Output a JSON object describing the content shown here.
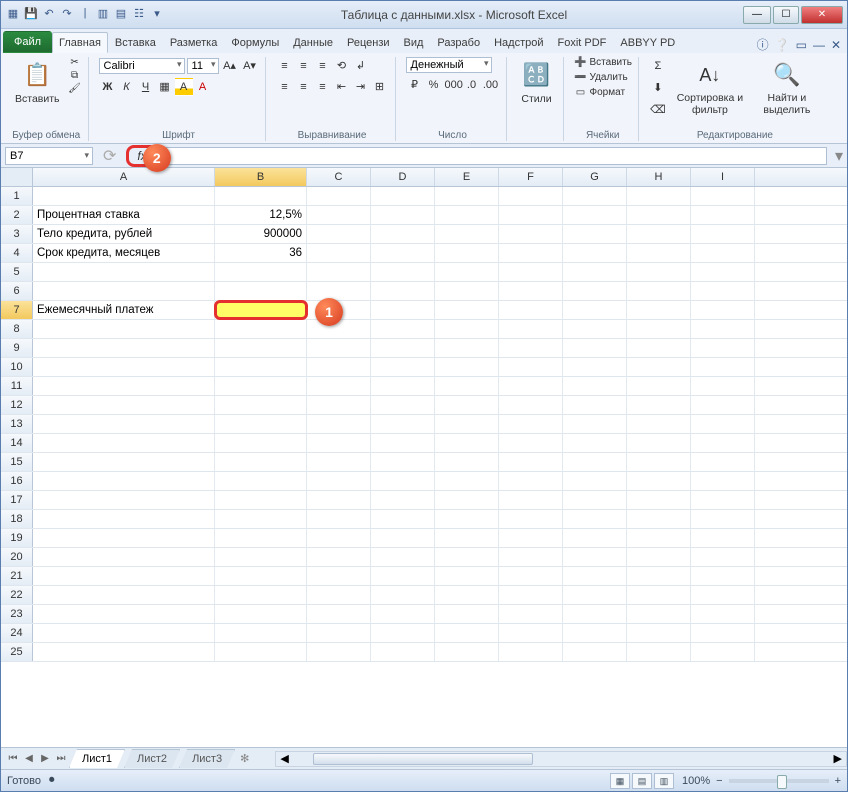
{
  "window": {
    "title": "Таблица с данными.xlsx - Microsoft Excel"
  },
  "qat": [
    "excel-icon",
    "save",
    "undo",
    "redo",
    "|",
    "qat1",
    "qat2",
    "qat3",
    "qat4"
  ],
  "tabs": {
    "file": "Файл",
    "items": [
      "Главная",
      "Вставка",
      "Разметка",
      "Формулы",
      "Данные",
      "Рецензи",
      "Вид",
      "Разрабо",
      "Надстрой",
      "Foxit PDF",
      "ABBYY PD"
    ],
    "active_index": 0
  },
  "ribbon": {
    "clipboard": {
      "paste": "Вставить",
      "label": "Буфер обмена"
    },
    "font": {
      "name": "Calibri",
      "size": "11",
      "label": "Шрифт"
    },
    "align": {
      "label": "Выравнивание"
    },
    "number": {
      "format": "Денежный",
      "label": "Число"
    },
    "styles": {
      "btn": "Стили"
    },
    "cells": {
      "insert": "Вставить",
      "delete": "Удалить",
      "format": "Формат",
      "label": "Ячейки"
    },
    "editing": {
      "sort": "Сортировка и фильтр",
      "find": "Найти и выделить",
      "label": "Редактирование"
    }
  },
  "namebox": "B7",
  "formula": "",
  "columns": [
    "A",
    "B",
    "C",
    "D",
    "E",
    "F",
    "G",
    "H",
    "I"
  ],
  "col_widths": [
    "colA",
    "colB",
    "colC",
    "colD",
    "colE",
    "colF",
    "colG",
    "colH",
    "colI"
  ],
  "selected_col_index": 1,
  "rows": [
    {
      "n": 1,
      "cells": [
        "",
        "",
        "",
        "",
        "",
        "",
        "",
        "",
        ""
      ]
    },
    {
      "n": 2,
      "cells": [
        "Процентная ставка",
        "12,5%",
        "",
        "",
        "",
        "",
        "",
        "",
        ""
      ],
      "num_cols": [
        1
      ]
    },
    {
      "n": 3,
      "cells": [
        "Тело кредита, рублей",
        "900000",
        "",
        "",
        "",
        "",
        "",
        "",
        ""
      ],
      "num_cols": [
        1
      ]
    },
    {
      "n": 4,
      "cells": [
        "Срок кредита, месяцев",
        "36",
        "",
        "",
        "",
        "",
        "",
        "",
        ""
      ],
      "num_cols": [
        1
      ]
    },
    {
      "n": 5,
      "cells": [
        "",
        "",
        "",
        "",
        "",
        "",
        "",
        "",
        ""
      ]
    },
    {
      "n": 6,
      "cells": [
        "",
        "",
        "",
        "",
        "",
        "",
        "",
        "",
        ""
      ]
    },
    {
      "n": 7,
      "cells": [
        "Ежемесячный платеж",
        "",
        "",
        "",
        "",
        "",
        "",
        "",
        ""
      ],
      "selected_col": 1
    },
    {
      "n": 8,
      "cells": [
        "",
        "",
        "",
        "",
        "",
        "",
        "",
        "",
        ""
      ]
    },
    {
      "n": 9,
      "cells": [
        "",
        "",
        "",
        "",
        "",
        "",
        "",
        "",
        ""
      ]
    },
    {
      "n": 10,
      "cells": [
        "",
        "",
        "",
        "",
        "",
        "",
        "",
        "",
        ""
      ]
    },
    {
      "n": 11,
      "cells": [
        "",
        "",
        "",
        "",
        "",
        "",
        "",
        "",
        ""
      ]
    },
    {
      "n": 12,
      "cells": [
        "",
        "",
        "",
        "",
        "",
        "",
        "",
        "",
        ""
      ]
    },
    {
      "n": 13,
      "cells": [
        "",
        "",
        "",
        "",
        "",
        "",
        "",
        "",
        ""
      ]
    },
    {
      "n": 14,
      "cells": [
        "",
        "",
        "",
        "",
        "",
        "",
        "",
        "",
        ""
      ]
    },
    {
      "n": 15,
      "cells": [
        "",
        "",
        "",
        "",
        "",
        "",
        "",
        "",
        ""
      ]
    },
    {
      "n": 16,
      "cells": [
        "",
        "",
        "",
        "",
        "",
        "",
        "",
        "",
        ""
      ]
    },
    {
      "n": 17,
      "cells": [
        "",
        "",
        "",
        "",
        "",
        "",
        "",
        "",
        ""
      ]
    },
    {
      "n": 18,
      "cells": [
        "",
        "",
        "",
        "",
        "",
        "",
        "",
        "",
        ""
      ]
    },
    {
      "n": 19,
      "cells": [
        "",
        "",
        "",
        "",
        "",
        "",
        "",
        "",
        ""
      ]
    },
    {
      "n": 20,
      "cells": [
        "",
        "",
        "",
        "",
        "",
        "",
        "",
        "",
        ""
      ]
    },
    {
      "n": 21,
      "cells": [
        "",
        "",
        "",
        "",
        "",
        "",
        "",
        "",
        ""
      ]
    },
    {
      "n": 22,
      "cells": [
        "",
        "",
        "",
        "",
        "",
        "",
        "",
        "",
        ""
      ]
    },
    {
      "n": 23,
      "cells": [
        "",
        "",
        "",
        "",
        "",
        "",
        "",
        "",
        ""
      ]
    },
    {
      "n": 24,
      "cells": [
        "",
        "",
        "",
        "",
        "",
        "",
        "",
        "",
        ""
      ]
    },
    {
      "n": 25,
      "cells": [
        "",
        "",
        "",
        "",
        "",
        "",
        "",
        "",
        ""
      ]
    }
  ],
  "sheets": [
    "Лист1",
    "Лист2",
    "Лист3"
  ],
  "active_sheet": 0,
  "status": {
    "ready": "Готово",
    "zoom": "100%"
  },
  "callouts": {
    "one": "1",
    "two": "2"
  }
}
